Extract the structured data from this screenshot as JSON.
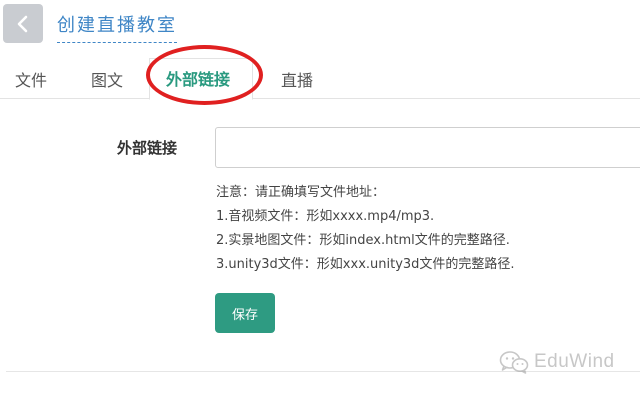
{
  "header": {
    "title": "创建直播教室"
  },
  "tabs": [
    {
      "label": "文件",
      "active": false
    },
    {
      "label": "图文",
      "active": false
    },
    {
      "label": "外部链接",
      "active": true
    },
    {
      "label": "直播",
      "active": false
    }
  ],
  "form": {
    "field_label": "外部链接",
    "field_value": "",
    "field_placeholder": "",
    "notes": [
      "注意：请正确填写文件地址：",
      "1.音视频文件：形如xxxx.mp4/mp3.",
      "2.实景地图文件：形如index.html文件的完整路径.",
      "3.unity3d文件：形如xxx.unity3d文件的完整路径."
    ],
    "save_label": "保存"
  },
  "watermark": {
    "text": "EduWind",
    "icon": "wechat-icon"
  },
  "colors": {
    "accent": "#2e9b82",
    "title_blue": "#3f86c6",
    "highlight_red": "#e02020"
  }
}
